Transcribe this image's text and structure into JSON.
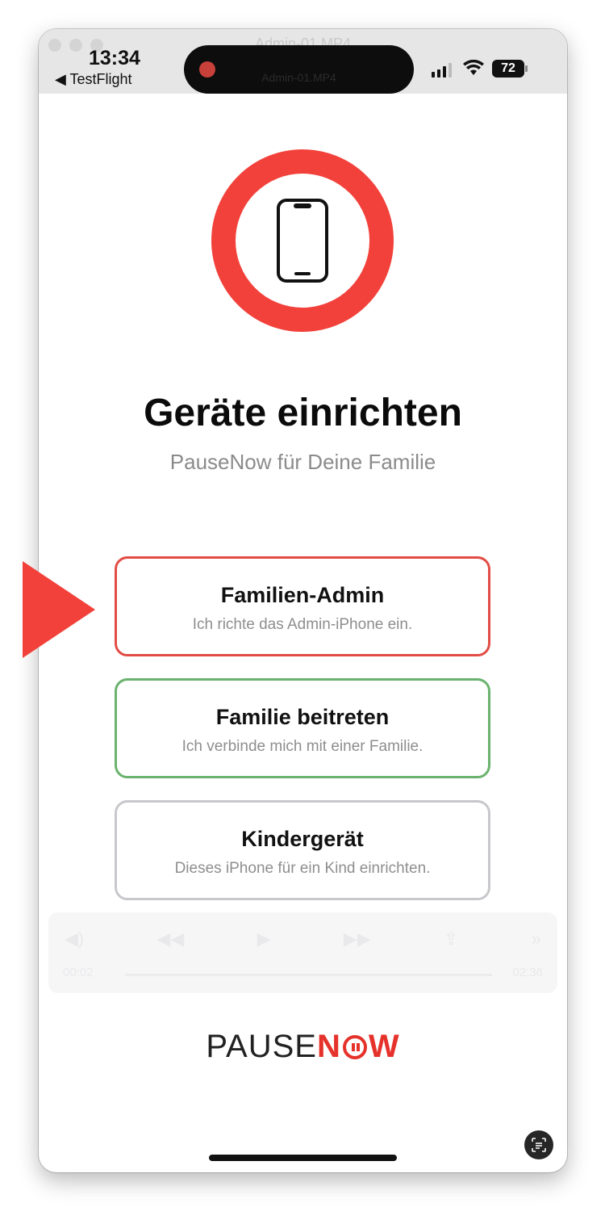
{
  "window": {
    "title": "Admin-01.MP4"
  },
  "status_bar": {
    "time": "13:34",
    "back_app": "◀ TestFlight",
    "island_label": "Admin-01.MP4",
    "battery": "72"
  },
  "header": {
    "title": "Geräte einrichten",
    "subtitle": "PauseNow für Deine Familie"
  },
  "options": [
    {
      "title": "Familien-Admin",
      "subtitle": "Ich richte das Admin-iPhone ein.",
      "accent": "#e24c45"
    },
    {
      "title": "Familie beitreten",
      "subtitle": "Ich verbinde mich mit einer Familie.",
      "accent": "#6ab26e"
    },
    {
      "title": "Kindergerät",
      "subtitle": "Dieses iPhone für ein Kind einrichten.",
      "accent": "#c8c8cc"
    }
  ],
  "player": {
    "elapsed": "00:02",
    "remaining": "02:36"
  },
  "logo": {
    "part1": "PAUSE",
    "part2_n": "N",
    "part2_w": "W"
  },
  "colors": {
    "brand_red": "#f2413a"
  },
  "icons": {
    "hero": "smartphone-icon",
    "arrow": "pointer-arrow-icon",
    "scan": "scan-text-icon"
  }
}
